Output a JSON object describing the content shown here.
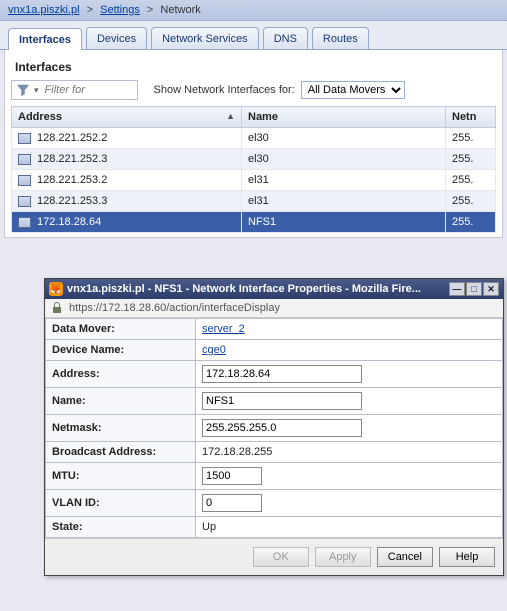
{
  "breadcrumb": {
    "host": "vnx1a.piszki.pl",
    "mid": "Settings",
    "cur": "Network"
  },
  "tabs": {
    "interfaces": "Interfaces",
    "devices": "Devices",
    "services": "Network Services",
    "dns": "DNS",
    "routes": "Routes"
  },
  "section_title": "Interfaces",
  "filter_placeholder": "Filter for",
  "show_label": "Show Network Interfaces for:",
  "scope_select": "All Data Movers",
  "columns": {
    "address": "Address",
    "name": "Name",
    "netmask": "Netn"
  },
  "rows": [
    {
      "address": "128.221.252.2",
      "name": "el30",
      "netmask": "255."
    },
    {
      "address": "128.221.252.3",
      "name": "el30",
      "netmask": "255."
    },
    {
      "address": "128.221.253.2",
      "name": "el31",
      "netmask": "255."
    },
    {
      "address": "128.221.253.3",
      "name": "el31",
      "netmask": "255."
    },
    {
      "address": "172.18.28.64",
      "name": "NFS1",
      "netmask": "255."
    }
  ],
  "dialog": {
    "title": "vnx1a.piszki.pl - NFS1 - Network Interface Properties - Mozilla Fire...",
    "url": "https://172.18.28.60/action/interfaceDisplay",
    "labels": {
      "data_mover": "Data Mover:",
      "device_name": "Device Name:",
      "address": "Address:",
      "name": "Name:",
      "netmask": "Netmask:",
      "broadcast": "Broadcast Address:",
      "mtu": "MTU:",
      "vlan": "VLAN ID:",
      "state": "State:"
    },
    "values": {
      "data_mover": "server_2",
      "device_name": "cge0",
      "address": "172.18.28.64",
      "name": "NFS1",
      "netmask": "255.255.255.0",
      "broadcast": "172.18.28.255",
      "mtu": "1500",
      "vlan": "0",
      "state": "Up"
    },
    "buttons": {
      "ok": "OK",
      "apply": "Apply",
      "cancel": "Cancel",
      "help": "Help"
    }
  }
}
